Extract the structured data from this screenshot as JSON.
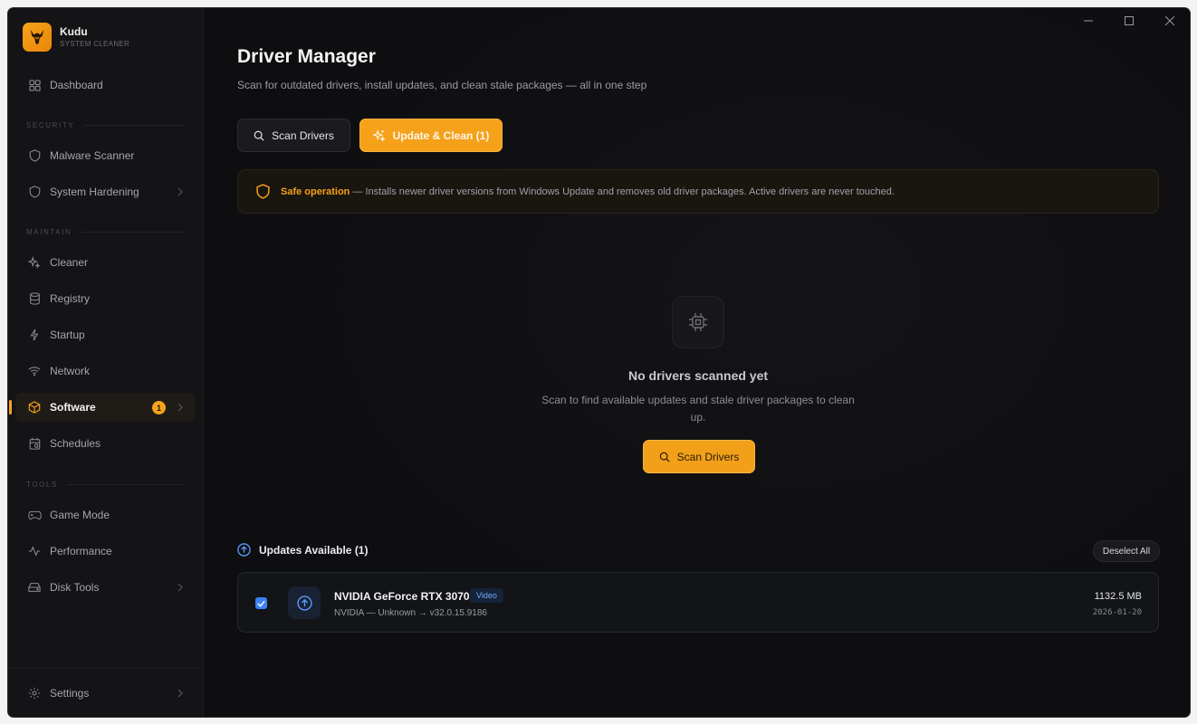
{
  "app": {
    "name": "Kudu",
    "subtitle": "SYSTEM CLEANER"
  },
  "sidebar": {
    "dashboard": "Dashboard",
    "sections": {
      "security": "SECURITY",
      "maintain": "MAINTAIN",
      "tools": "TOOLS"
    },
    "items": {
      "malware": "Malware Scanner",
      "hardening": "System Hardening",
      "cleaner": "Cleaner",
      "registry": "Registry",
      "startup": "Startup",
      "network": "Network",
      "software": "Software",
      "software_badge": "1",
      "schedules": "Schedules",
      "game_mode": "Game Mode",
      "performance": "Performance",
      "disk_tools": "Disk Tools"
    },
    "settings": "Settings"
  },
  "main": {
    "title": "Driver Manager",
    "subtitle": "Scan for outdated drivers, install updates, and clean stale packages — all in one step",
    "scan_button": "Scan Drivers",
    "update_button": "Update & Clean (1)",
    "notice": {
      "strong": "Safe operation",
      "text": "— Installs newer driver versions from Windows Update and removes old driver packages. Active drivers are never touched."
    },
    "empty": {
      "title": "No drivers scanned yet",
      "text": "Scan to find available updates and stale driver packages to clean up.",
      "button": "Scan Drivers"
    },
    "updates": {
      "heading": "Updates Available (1)",
      "deselect": "Deselect All",
      "drivers": [
        {
          "name": "NVIDIA GeForce RTX 3070",
          "tag": "Video",
          "version": "NVIDIA — Unknown → v32.0.15.9186",
          "size": "1132.5 MB",
          "date": "2026-01-20",
          "checked": true
        }
      ]
    }
  },
  "colors": {
    "accent": "#f5a11a",
    "background": "#0e0e10",
    "sidebar": "#141416",
    "check": "#3b82f6"
  }
}
